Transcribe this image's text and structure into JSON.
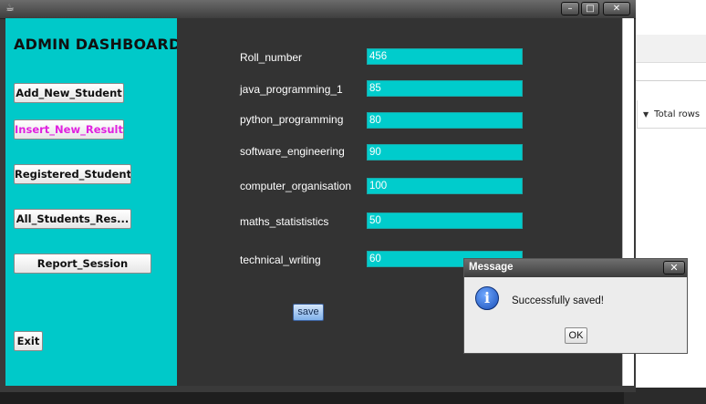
{
  "window": {
    "title_icon": "app-icon",
    "controls": {
      "minimize": "–",
      "maximize": "□",
      "close": "✕"
    }
  },
  "sidebar": {
    "title": "ADMIN DASHBOARD",
    "buttons": [
      {
        "label": "Add_New_Student",
        "active": false
      },
      {
        "label": "Insert_New_Result",
        "active": true
      },
      {
        "label": "Registered_Student",
        "active": false
      },
      {
        "label": "All_Students_Res...",
        "active": false
      },
      {
        "label": "Report_Session",
        "active": false
      },
      {
        "label": "Exit",
        "active": false
      }
    ],
    "active_color": "#e020e0",
    "background_color": "#00c9c9"
  },
  "form": {
    "fields": [
      {
        "label": "Roll_number",
        "value": "456"
      },
      {
        "label": "java_programming_1",
        "value": "85"
      },
      {
        "label": "python_programming",
        "value": "80"
      },
      {
        "label": "software_engineering",
        "value": "90"
      },
      {
        "label": "computer_organisation",
        "value": "100"
      },
      {
        "label": "maths_statististics",
        "value": "50"
      },
      {
        "label": "technical_writing",
        "value": "60"
      }
    ],
    "save_label": "save",
    "input_color": "#00cccc"
  },
  "dialog": {
    "title": "Message",
    "close_label": "✕",
    "icon": "info-icon",
    "icon_glyph": "i",
    "message": "Successfully saved!",
    "ok_label": "OK"
  },
  "background_app": {
    "dropdown_glyph": "▼",
    "column_header": "Total rows"
  }
}
